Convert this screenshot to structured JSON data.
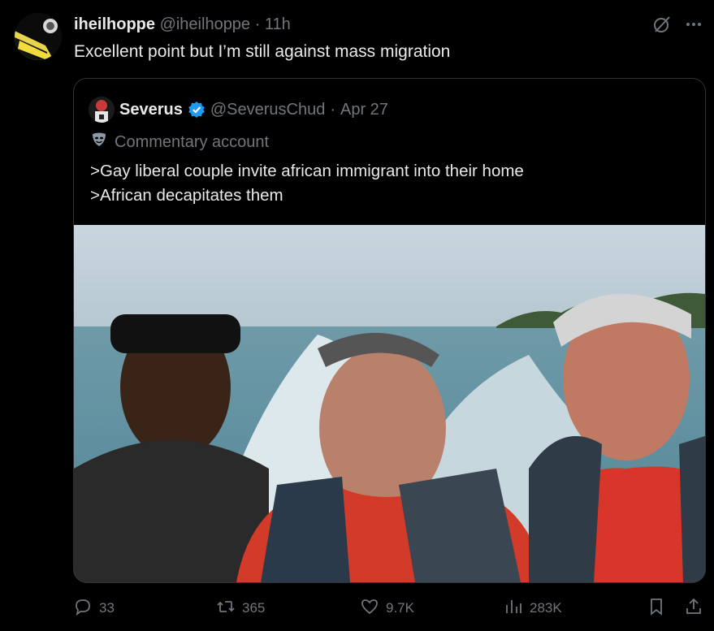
{
  "tweet": {
    "display_name": "iheilhoppe",
    "handle": "@iheilhoppe",
    "separator": "·",
    "time": "11h",
    "text": "Excellent point but I’m still against mass migration"
  },
  "quote": {
    "display_name": "Severus",
    "handle": "@SeverusChud",
    "separator": "·",
    "date": "Apr 27",
    "label": "Commentary account",
    "line1": ">Gay liberal couple invite african immigrant into their home",
    "line2": ">African decapitates them"
  },
  "actions": {
    "replies": "33",
    "reposts": "365",
    "likes": "9.7K",
    "views": "283K"
  },
  "icons": {
    "grok": "grok-icon",
    "more": "more-icon",
    "verified": "verified-badge-icon",
    "mask": "mask-icon",
    "reply": "reply-icon",
    "repost": "repost-icon",
    "like": "heart-icon",
    "views": "views-icon",
    "bookmark": "bookmark-icon",
    "share": "share-icon"
  },
  "colors": {
    "background": "#000000",
    "text": "#e7e9ea",
    "muted": "#71767b",
    "border": "#2f3336",
    "verified": "#1d9bf0"
  }
}
